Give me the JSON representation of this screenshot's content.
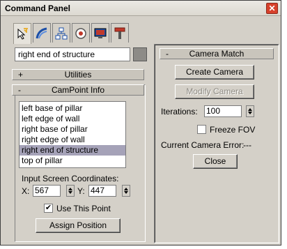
{
  "window": {
    "title": "Command Panel",
    "close_glyph": "✕"
  },
  "toolbar": {
    "tabs": [
      {
        "icon": "create-cursor-icon"
      },
      {
        "icon": "modify-curve-icon"
      },
      {
        "icon": "hierarchy-icon"
      },
      {
        "icon": "motion-icon"
      },
      {
        "icon": "display-icon"
      },
      {
        "icon": "utilities-hammer-icon"
      }
    ]
  },
  "object_name": "right end of structure",
  "rollouts": {
    "utilities": {
      "sign": "+",
      "label": "Utilities"
    },
    "campoint": {
      "sign": "-",
      "label": "CamPoint Info"
    },
    "camera_match": {
      "sign": "-",
      "label": "Camera Match"
    }
  },
  "campoint": {
    "list": [
      "left base of pillar",
      "left edge of wall",
      "right base of pillar",
      "right edge of wall",
      "right end of structure",
      "top of pillar"
    ],
    "selected": "right end of structure",
    "coords_label": "Input Screen Coordinates:",
    "x_label": "X:",
    "x_value": "567",
    "y_label": "Y:",
    "y_value": "447",
    "use_point_label": "Use This Point",
    "use_point_checked": "✔",
    "assign_label": "Assign Position"
  },
  "camera_match": {
    "create_label": "Create Camera",
    "modify_label": "Modify Camera",
    "iterations_label": "Iterations:",
    "iterations_value": "100",
    "freeze_label": "Freeze FOV",
    "error_label": "Current Camera Error:",
    "error_value": "---",
    "close_label": "Close"
  }
}
